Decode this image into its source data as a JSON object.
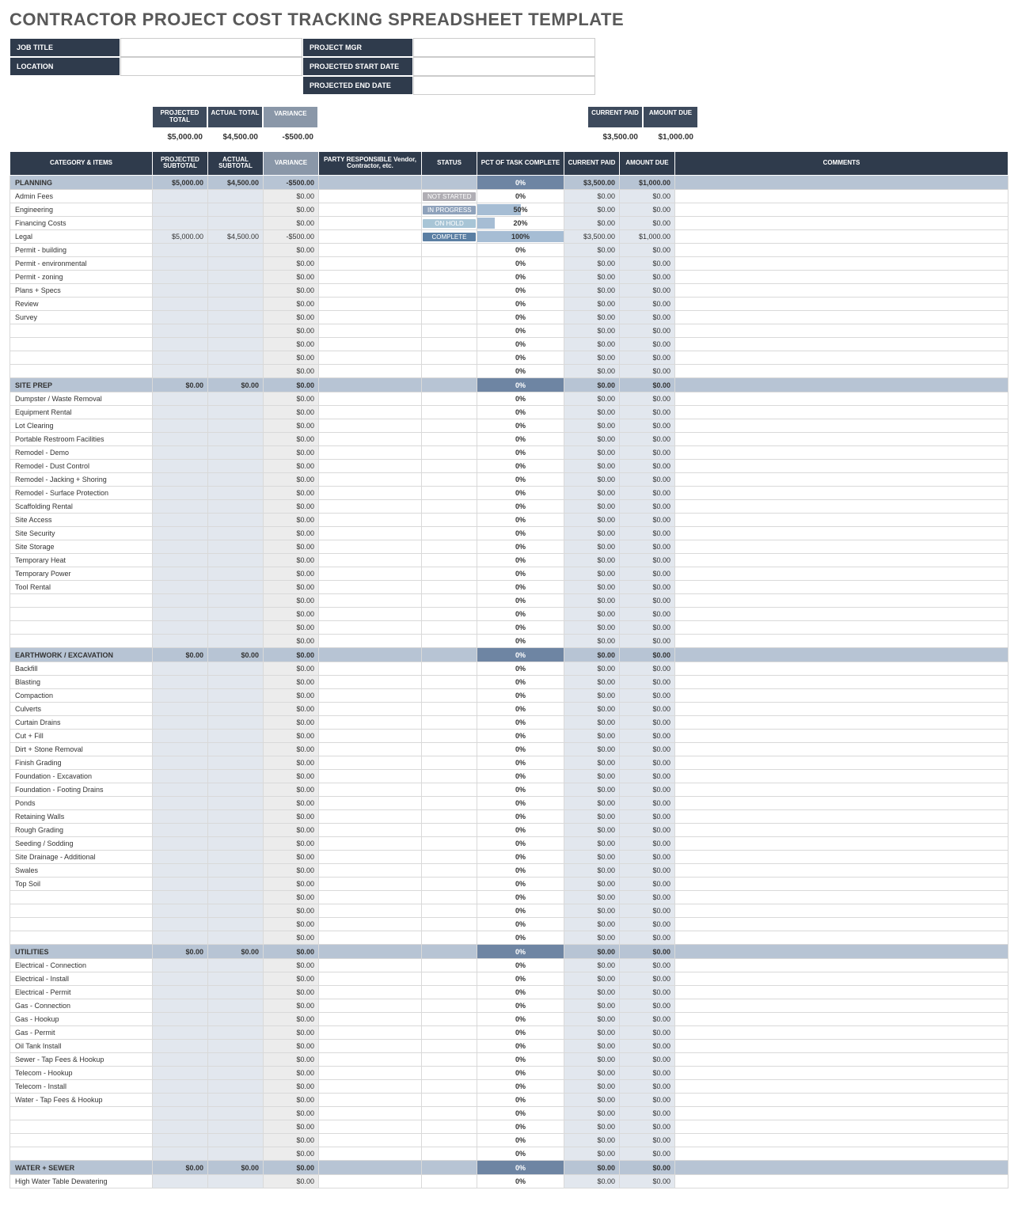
{
  "title": "CONTRACTOR PROJECT COST TRACKING SPREADSHEET TEMPLATE",
  "hdr": {
    "jobTitle": "JOB TITLE",
    "projectMgr": "PROJECT MGR",
    "location": "LOCATION",
    "startDate": "PROJECTED START DATE",
    "endDate": "PROJECTED END DATE"
  },
  "sumLbl": {
    "projTotal": "PROJECTED TOTAL",
    "actTotal": "ACTUAL TOTAL",
    "variance": "VARIANCE",
    "curPaid": "CURRENT PAID",
    "amtDue": "AMOUNT DUE"
  },
  "sumVal": {
    "projTotal": "$5,000.00",
    "actTotal": "$4,500.00",
    "variance": "-$500.00",
    "curPaid": "$3,500.00",
    "amtDue": "$1,000.00"
  },
  "cols": {
    "cat": "CATEGORY & ITEMS",
    "projSub": "PROJECTED SUBTOTAL",
    "actSub": "ACTUAL SUBTOTAL",
    "variance": "VARIANCE",
    "party": "PARTY RESPONSIBLE Vendor, Contractor, etc.",
    "status": "STATUS",
    "pct": "PCT OF TASK COMPLETE",
    "curPaid": "CURRENT PAID",
    "amtDue": "AMOUNT DUE",
    "comments": "COMMENTS"
  },
  "sections": [
    {
      "name": "PLANNING",
      "proj": "$5,000.00",
      "act": "$4,500.00",
      "var": "-$500.00",
      "pct": "0%",
      "paid": "$3,500.00",
      "due": "$1,000.00",
      "rows": [
        {
          "item": "Admin Fees",
          "var": "$0.00",
          "status": "NOT STARTED",
          "sc": "ns",
          "pct": 0,
          "paid": "$0.00",
          "due": "$0.00"
        },
        {
          "item": "Engineering",
          "var": "$0.00",
          "status": "IN PROGRESS",
          "sc": "ip",
          "pct": 50,
          "paid": "$0.00",
          "due": "$0.00"
        },
        {
          "item": "Financing Costs",
          "var": "$0.00",
          "status": "ON HOLD",
          "sc": "oh",
          "pct": 20,
          "paid": "$0.00",
          "due": "$0.00"
        },
        {
          "item": "Legal",
          "proj": "$5,000.00",
          "act": "$4,500.00",
          "var": "-$500.00",
          "status": "COMPLETE",
          "sc": "cp",
          "pct": 100,
          "paid": "$3,500.00",
          "due": "$1,000.00"
        },
        {
          "item": "Permit - building",
          "var": "$0.00",
          "pct": 0,
          "paid": "$0.00",
          "due": "$0.00"
        },
        {
          "item": "Permit - environmental",
          "var": "$0.00",
          "pct": 0,
          "paid": "$0.00",
          "due": "$0.00"
        },
        {
          "item": "Permit - zoning",
          "var": "$0.00",
          "pct": 0,
          "paid": "$0.00",
          "due": "$0.00"
        },
        {
          "item": "Plans + Specs",
          "var": "$0.00",
          "pct": 0,
          "paid": "$0.00",
          "due": "$0.00"
        },
        {
          "item": "Review",
          "var": "$0.00",
          "pct": 0,
          "paid": "$0.00",
          "due": "$0.00"
        },
        {
          "item": "Survey",
          "var": "$0.00",
          "pct": 0,
          "paid": "$0.00",
          "due": "$0.00"
        },
        {
          "item": "",
          "var": "$0.00",
          "pct": 0,
          "paid": "$0.00",
          "due": "$0.00"
        },
        {
          "item": "",
          "var": "$0.00",
          "pct": 0,
          "paid": "$0.00",
          "due": "$0.00"
        },
        {
          "item": "",
          "var": "$0.00",
          "pct": 0,
          "paid": "$0.00",
          "due": "$0.00"
        },
        {
          "item": "",
          "var": "$0.00",
          "pct": 0,
          "paid": "$0.00",
          "due": "$0.00"
        }
      ]
    },
    {
      "name": "SITE PREP",
      "proj": "$0.00",
      "act": "$0.00",
      "var": "$0.00",
      "pct": "0%",
      "paid": "$0.00",
      "due": "$0.00",
      "rows": [
        {
          "item": "Dumpster / Waste Removal",
          "var": "$0.00",
          "pct": 0,
          "paid": "$0.00",
          "due": "$0.00"
        },
        {
          "item": "Equipment Rental",
          "var": "$0.00",
          "pct": 0,
          "paid": "$0.00",
          "due": "$0.00"
        },
        {
          "item": "Lot Clearing",
          "var": "$0.00",
          "pct": 0,
          "paid": "$0.00",
          "due": "$0.00"
        },
        {
          "item": "Portable Restroom Facilities",
          "var": "$0.00",
          "pct": 0,
          "paid": "$0.00",
          "due": "$0.00"
        },
        {
          "item": "Remodel - Demo",
          "var": "$0.00",
          "pct": 0,
          "paid": "$0.00",
          "due": "$0.00"
        },
        {
          "item": "Remodel - Dust Control",
          "var": "$0.00",
          "pct": 0,
          "paid": "$0.00",
          "due": "$0.00"
        },
        {
          "item": "Remodel - Jacking + Shoring",
          "var": "$0.00",
          "pct": 0,
          "paid": "$0.00",
          "due": "$0.00"
        },
        {
          "item": "Remodel - Surface Protection",
          "var": "$0.00",
          "pct": 0,
          "paid": "$0.00",
          "due": "$0.00"
        },
        {
          "item": "Scaffolding Rental",
          "var": "$0.00",
          "pct": 0,
          "paid": "$0.00",
          "due": "$0.00"
        },
        {
          "item": "Site Access",
          "var": "$0.00",
          "pct": 0,
          "paid": "$0.00",
          "due": "$0.00"
        },
        {
          "item": "Site Security",
          "var": "$0.00",
          "pct": 0,
          "paid": "$0.00",
          "due": "$0.00"
        },
        {
          "item": "Site Storage",
          "var": "$0.00",
          "pct": 0,
          "paid": "$0.00",
          "due": "$0.00"
        },
        {
          "item": "Temporary Heat",
          "var": "$0.00",
          "pct": 0,
          "paid": "$0.00",
          "due": "$0.00"
        },
        {
          "item": "Temporary Power",
          "var": "$0.00",
          "pct": 0,
          "paid": "$0.00",
          "due": "$0.00"
        },
        {
          "item": "Tool Rental",
          "var": "$0.00",
          "pct": 0,
          "paid": "$0.00",
          "due": "$0.00"
        },
        {
          "item": "",
          "var": "$0.00",
          "pct": 0,
          "paid": "$0.00",
          "due": "$0.00"
        },
        {
          "item": "",
          "var": "$0.00",
          "pct": 0,
          "paid": "$0.00",
          "due": "$0.00"
        },
        {
          "item": "",
          "var": "$0.00",
          "pct": 0,
          "paid": "$0.00",
          "due": "$0.00"
        },
        {
          "item": "",
          "var": "$0.00",
          "pct": 0,
          "paid": "$0.00",
          "due": "$0.00"
        }
      ]
    },
    {
      "name": "EARTHWORK / EXCAVATION",
      "proj": "$0.00",
      "act": "$0.00",
      "var": "$0.00",
      "pct": "0%",
      "paid": "$0.00",
      "due": "$0.00",
      "rows": [
        {
          "item": "Backfill",
          "var": "$0.00",
          "pct": 0,
          "paid": "$0.00",
          "due": "$0.00"
        },
        {
          "item": "Blasting",
          "var": "$0.00",
          "pct": 0,
          "paid": "$0.00",
          "due": "$0.00"
        },
        {
          "item": "Compaction",
          "var": "$0.00",
          "pct": 0,
          "paid": "$0.00",
          "due": "$0.00"
        },
        {
          "item": "Culverts",
          "var": "$0.00",
          "pct": 0,
          "paid": "$0.00",
          "due": "$0.00"
        },
        {
          "item": "Curtain Drains",
          "var": "$0.00",
          "pct": 0,
          "paid": "$0.00",
          "due": "$0.00"
        },
        {
          "item": "Cut + Fill",
          "var": "$0.00",
          "pct": 0,
          "paid": "$0.00",
          "due": "$0.00"
        },
        {
          "item": "Dirt + Stone Removal",
          "var": "$0.00",
          "pct": 0,
          "paid": "$0.00",
          "due": "$0.00"
        },
        {
          "item": "Finish Grading",
          "var": "$0.00",
          "pct": 0,
          "paid": "$0.00",
          "due": "$0.00"
        },
        {
          "item": "Foundation - Excavation",
          "var": "$0.00",
          "pct": 0,
          "paid": "$0.00",
          "due": "$0.00"
        },
        {
          "item": "Foundation - Footing Drains",
          "var": "$0.00",
          "pct": 0,
          "paid": "$0.00",
          "due": "$0.00"
        },
        {
          "item": "Ponds",
          "var": "$0.00",
          "pct": 0,
          "paid": "$0.00",
          "due": "$0.00"
        },
        {
          "item": "Retaining Walls",
          "var": "$0.00",
          "pct": 0,
          "paid": "$0.00",
          "due": "$0.00"
        },
        {
          "item": "Rough Grading",
          "var": "$0.00",
          "pct": 0,
          "paid": "$0.00",
          "due": "$0.00"
        },
        {
          "item": "Seeding / Sodding",
          "var": "$0.00",
          "pct": 0,
          "paid": "$0.00",
          "due": "$0.00"
        },
        {
          "item": "Site Drainage - Additional",
          "var": "$0.00",
          "pct": 0,
          "paid": "$0.00",
          "due": "$0.00"
        },
        {
          "item": "Swales",
          "var": "$0.00",
          "pct": 0,
          "paid": "$0.00",
          "due": "$0.00"
        },
        {
          "item": "Top Soil",
          "var": "$0.00",
          "pct": 0,
          "paid": "$0.00",
          "due": "$0.00"
        },
        {
          "item": "",
          "var": "$0.00",
          "pct": 0,
          "paid": "$0.00",
          "due": "$0.00"
        },
        {
          "item": "",
          "var": "$0.00",
          "pct": 0,
          "paid": "$0.00",
          "due": "$0.00"
        },
        {
          "item": "",
          "var": "$0.00",
          "pct": 0,
          "paid": "$0.00",
          "due": "$0.00"
        },
        {
          "item": "",
          "var": "$0.00",
          "pct": 0,
          "paid": "$0.00",
          "due": "$0.00"
        }
      ]
    },
    {
      "name": "UTILITIES",
      "proj": "$0.00",
      "act": "$0.00",
      "var": "$0.00",
      "pct": "0%",
      "paid": "$0.00",
      "due": "$0.00",
      "rows": [
        {
          "item": "Electrical - Connection",
          "var": "$0.00",
          "pct": 0,
          "paid": "$0.00",
          "due": "$0.00"
        },
        {
          "item": "Electrical - Install",
          "var": "$0.00",
          "pct": 0,
          "paid": "$0.00",
          "due": "$0.00"
        },
        {
          "item": "Electrical - Permit",
          "var": "$0.00",
          "pct": 0,
          "paid": "$0.00",
          "due": "$0.00"
        },
        {
          "item": "Gas - Connection",
          "var": "$0.00",
          "pct": 0,
          "paid": "$0.00",
          "due": "$0.00"
        },
        {
          "item": "Gas - Hookup",
          "var": "$0.00",
          "pct": 0,
          "paid": "$0.00",
          "due": "$0.00"
        },
        {
          "item": "Gas - Permit",
          "var": "$0.00",
          "pct": 0,
          "paid": "$0.00",
          "due": "$0.00"
        },
        {
          "item": "Oil Tank Install",
          "var": "$0.00",
          "pct": 0,
          "paid": "$0.00",
          "due": "$0.00"
        },
        {
          "item": "Sewer - Tap Fees & Hookup",
          "var": "$0.00",
          "pct": 0,
          "paid": "$0.00",
          "due": "$0.00"
        },
        {
          "item": "Telecom - Hookup",
          "var": "$0.00",
          "pct": 0,
          "paid": "$0.00",
          "due": "$0.00"
        },
        {
          "item": "Telecom - Install",
          "var": "$0.00",
          "pct": 0,
          "paid": "$0.00",
          "due": "$0.00"
        },
        {
          "item": "Water - Tap Fees & Hookup",
          "var": "$0.00",
          "pct": 0,
          "paid": "$0.00",
          "due": "$0.00"
        },
        {
          "item": "",
          "var": "$0.00",
          "pct": 0,
          "paid": "$0.00",
          "due": "$0.00"
        },
        {
          "item": "",
          "var": "$0.00",
          "pct": 0,
          "paid": "$0.00",
          "due": "$0.00"
        },
        {
          "item": "",
          "var": "$0.00",
          "pct": 0,
          "paid": "$0.00",
          "due": "$0.00"
        },
        {
          "item": "",
          "var": "$0.00",
          "pct": 0,
          "paid": "$0.00",
          "due": "$0.00"
        }
      ]
    },
    {
      "name": "WATER + SEWER",
      "proj": "$0.00",
      "act": "$0.00",
      "var": "$0.00",
      "pct": "0%",
      "paid": "$0.00",
      "due": "$0.00",
      "rows": [
        {
          "item": "High Water Table Dewatering",
          "var": "$0.00",
          "pct": 0,
          "paid": "$0.00",
          "due": "$0.00"
        }
      ]
    }
  ]
}
